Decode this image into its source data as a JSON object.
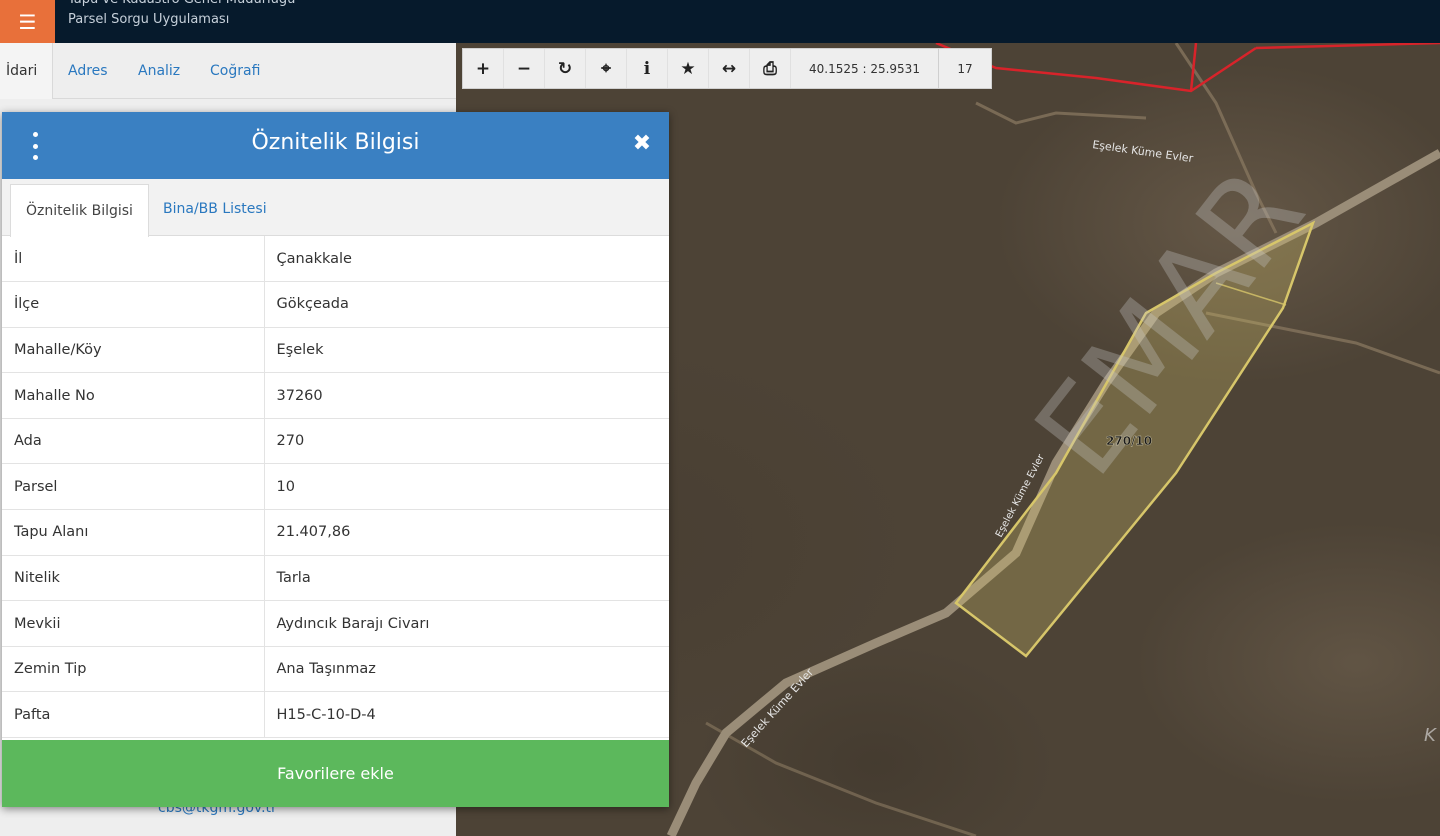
{
  "header": {
    "title": "Tapu ve Kadastro Genel Müdürlüğü",
    "subtitle": "Parsel Sorgu Uygulaması",
    "menu_icon": "hamburger-icon",
    "menu_color": "#e8703a"
  },
  "sidebar": {
    "tabs": [
      {
        "label": "İdari"
      },
      {
        "label": "Adres"
      },
      {
        "label": "Analiz"
      },
      {
        "label": "Coğrafi"
      }
    ],
    "email": "cbs@tkgm.gov.tr"
  },
  "toolbar": {
    "buttons": [
      {
        "name": "zoom-in-icon",
        "glyph": "+"
      },
      {
        "name": "zoom-out-icon",
        "glyph": "−"
      },
      {
        "name": "refresh-icon",
        "glyph": "↻"
      },
      {
        "name": "locate-icon",
        "glyph": "⌖"
      },
      {
        "name": "info-icon",
        "glyph": "i"
      },
      {
        "name": "star-icon",
        "glyph": "★"
      },
      {
        "name": "measure-icon",
        "glyph": "↔"
      },
      {
        "name": "print-icon",
        "glyph": "⎙"
      }
    ],
    "coordinates": "40.1525 : 25.9531",
    "zoom_level": "17"
  },
  "map": {
    "parcel_label": "270/10",
    "road_label_top": "Eşelek Küme Evler",
    "road_label_bottom": "Eşelek Küme Evler",
    "road_label_mid": "Eşelek Küme Evler",
    "watermark": "EMAR",
    "edge_letter": "K",
    "parcel_outline_color": "#d7c66a",
    "boundary_color": "#d8232a"
  },
  "dialog": {
    "title": "Öznitelik Bilgisi",
    "close_icon": "close-icon",
    "tabs": [
      {
        "label": "Öznitelik Bilgisi"
      },
      {
        "label": "Bina/BB Listesi"
      }
    ],
    "rows": [
      {
        "key": "İl",
        "value": "Çanakkale"
      },
      {
        "key": "İlçe",
        "value": "Gökçeada"
      },
      {
        "key": "Mahalle/Köy",
        "value": "Eşelek"
      },
      {
        "key": "Mahalle No",
        "value": "37260"
      },
      {
        "key": "Ada",
        "value": "270"
      },
      {
        "key": "Parsel",
        "value": "10"
      },
      {
        "key": "Tapu Alanı",
        "value": "21.407,86"
      },
      {
        "key": "Nitelik",
        "value": "Tarla"
      },
      {
        "key": "Mevkii",
        "value": "Aydıncık Barajı Civarı"
      },
      {
        "key": "Zemin Tip",
        "value": "Ana Taşınmaz"
      },
      {
        "key": "Pafta",
        "value": "H15-C-10-D-4"
      }
    ],
    "favorite_label": "Favorilere ekle",
    "header_color": "#3a80c2",
    "favorite_color": "#5cb85c"
  }
}
